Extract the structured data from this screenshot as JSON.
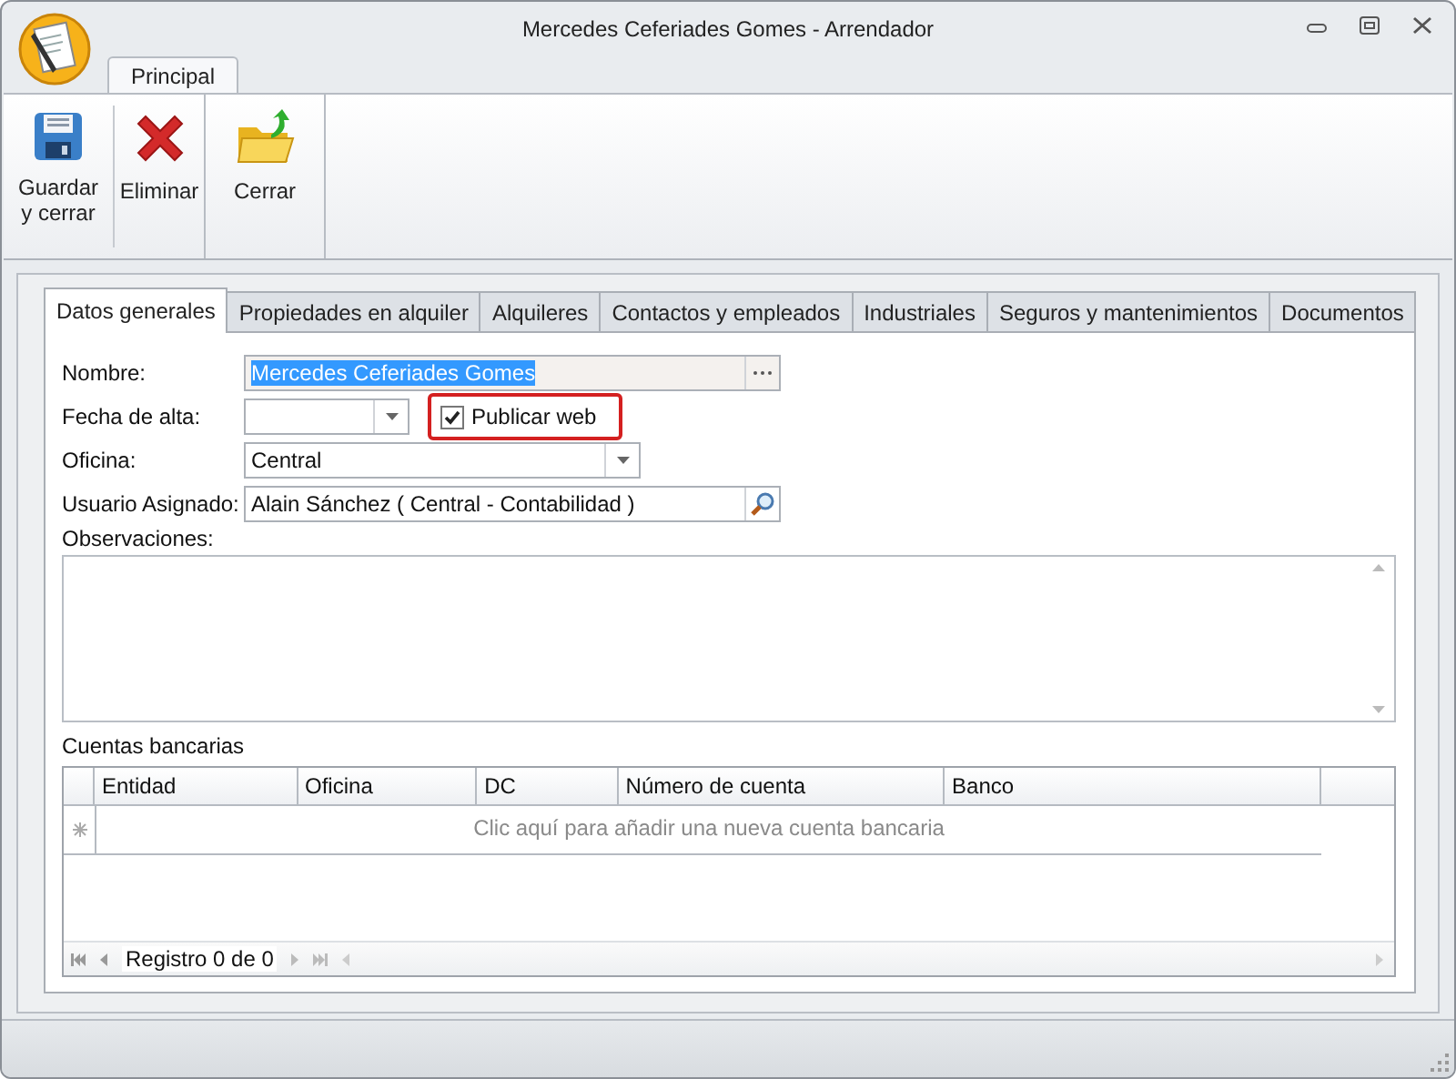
{
  "window": {
    "title": "Mercedes Ceferiades Gomes - Arrendador"
  },
  "ribbon": {
    "tabs": [
      {
        "label": "Principal",
        "selected": true
      }
    ],
    "buttons": [
      {
        "label": "Guardar y cerrar",
        "kind": "save"
      },
      {
        "label": "Eliminar",
        "kind": "delete"
      },
      {
        "label": "Cerrar",
        "kind": "close"
      }
    ]
  },
  "tabs": [
    {
      "label": "Datos generales",
      "selected": true
    },
    {
      "label": "Propiedades en alquiler",
      "selected": false
    },
    {
      "label": "Alquileres",
      "selected": false
    },
    {
      "label": "Contactos y empleados",
      "selected": false
    },
    {
      "label": "Industriales",
      "selected": false
    },
    {
      "label": "Seguros y mantenimientos",
      "selected": false
    },
    {
      "label": "Documentos",
      "selected": false
    }
  ],
  "fields": [
    {
      "label": "Nombre:",
      "kind": "ellipsis",
      "value": "Mercedes Ceferiades Gomes",
      "text_selected": true
    },
    {
      "label": "Fecha de alta:",
      "kind": "date",
      "checkbox": {
        "label": "Publicar web",
        "checked": true,
        "highlighted": true
      }
    },
    {
      "label": "Oficina:",
      "kind": "combo",
      "value": "Central"
    },
    {
      "label": "Usuario Asignado:",
      "kind": "lookup",
      "value": "Alain Sánchez ( Central - Contabilidad )"
    }
  ],
  "observaciones": {
    "label": "Observaciones:"
  },
  "accounts": {
    "label": "Cuentas bancarias",
    "columns": [
      "Entidad",
      "Oficina",
      "DC",
      "Número de cuenta",
      "Banco"
    ],
    "new_row": "Clic aquí para añadir una nueva cuenta bancaria",
    "navigator": "Registro 0 de 0"
  }
}
